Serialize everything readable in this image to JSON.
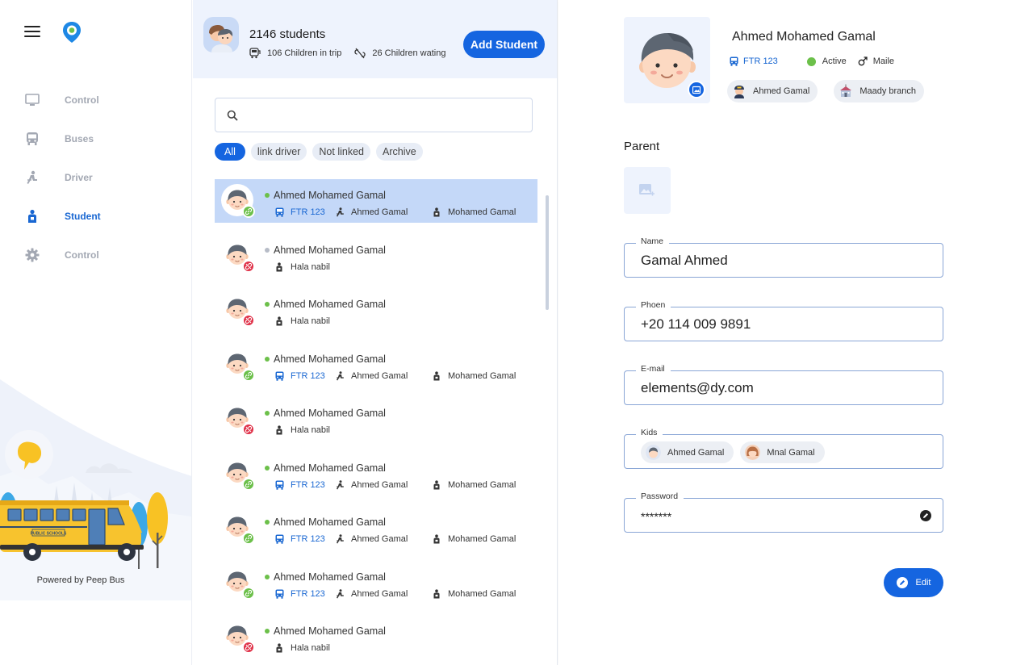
{
  "sidebar": {
    "items": [
      {
        "label": "Control",
        "icon": "monitor-icon",
        "active": false
      },
      {
        "label": "Buses",
        "icon": "bus-icon",
        "active": false
      },
      {
        "label": "Driver",
        "icon": "driver-icon",
        "active": false
      },
      {
        "label": "Student",
        "icon": "student-icon",
        "active": true
      },
      {
        "label": "Control",
        "icon": "gear-icon",
        "active": false
      }
    ],
    "powered_by": "Powered by Peep Bus",
    "bus_sign": "PUBLIC SCHOOLS"
  },
  "header": {
    "students_count": "2146 students",
    "in_trip": "106 Children in trip",
    "waiting": "26 Children wating",
    "add_button": "Add Student"
  },
  "search": {
    "placeholder": ""
  },
  "filters": [
    "All",
    "link driver",
    "Not linked",
    "Archive"
  ],
  "students": [
    {
      "name": "Ahmed Mohamed Gamal",
      "linked": true,
      "online": true,
      "selected": true,
      "bus": "FTR 123",
      "driver": "Ahmed Gamal",
      "parent": "Mohamed Gamal"
    },
    {
      "name": "Ahmed Mohamed Gamal",
      "linked": false,
      "online": false,
      "selected": false,
      "parent": "Hala nabil"
    },
    {
      "name": "Ahmed Mohamed Gamal",
      "linked": false,
      "online": true,
      "selected": false,
      "parent": "Hala nabil"
    },
    {
      "name": "Ahmed Mohamed Gamal",
      "linked": true,
      "online": true,
      "selected": false,
      "bus": "FTR 123",
      "driver": "Ahmed Gamal",
      "parent": "Mohamed Gamal"
    },
    {
      "name": "Ahmed Mohamed Gamal",
      "linked": false,
      "online": true,
      "selected": false,
      "parent": "Hala nabil"
    },
    {
      "name": "Ahmed Mohamed Gamal",
      "linked": true,
      "online": true,
      "selected": false,
      "bus": "FTR 123",
      "driver": "Ahmed Gamal",
      "parent": "Mohamed Gamal"
    },
    {
      "name": "Ahmed Mohamed Gamal",
      "linked": true,
      "online": true,
      "selected": false,
      "bus": "FTR 123",
      "driver": "Ahmed Gamal",
      "parent": "Mohamed Gamal"
    },
    {
      "name": "Ahmed Mohamed Gamal",
      "linked": true,
      "online": true,
      "selected": false,
      "bus": "FTR 123",
      "driver": "Ahmed Gamal",
      "parent": "Mohamed Gamal"
    },
    {
      "name": "Ahmed Mohamed Gamal",
      "linked": false,
      "online": true,
      "selected": false,
      "parent": "Hala nabil"
    }
  ],
  "profile": {
    "name": "Ahmed Mohamed Gamal",
    "bus": "FTR 123",
    "status": "Active",
    "gender": "Maile",
    "driver_tag": "Ahmed Gamal",
    "branch_tag": "Maady branch"
  },
  "parent": {
    "title": "Parent",
    "name_label": "Name",
    "name_value": "Gamal Ahmed",
    "phone_label": "Phoen",
    "phone_value": "+20 114 009 9891",
    "email_label": "E-mail",
    "email_value": "elements@dy.com",
    "kids_label": "Kids",
    "kids": [
      {
        "name": "Ahmed Gamal",
        "avatar": "boy"
      },
      {
        "name": "Mnal Gamal",
        "avatar": "girl"
      }
    ],
    "password_label": "Password",
    "password_value": "*******",
    "edit_button": "Edit"
  },
  "colors": {
    "accent": "#1565e0",
    "selected_row": "#c4d8f8",
    "header_bg": "#eef3fd",
    "status_green": "#6cc04a",
    "unlinked_red": "#e0334a",
    "bus_yellow": "#f7c32e"
  }
}
